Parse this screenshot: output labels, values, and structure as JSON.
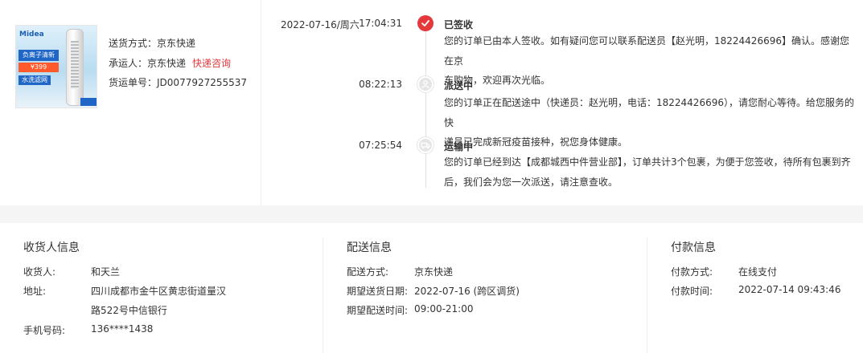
{
  "product": {
    "image_brand": "Midea",
    "image_tags": [
      "负离子清新",
      "¥399",
      "水洗滤网"
    ]
  },
  "shipping": {
    "method_label": "送货方式：",
    "method_value": "京东快递",
    "carrier_label": "承运人：",
    "carrier_value": "京东快递",
    "carrier_link": "快递咨询",
    "tracking_label": "货运单号：",
    "tracking_value": "JD0077927255537"
  },
  "timeline": {
    "date": "2022-07-16/周六",
    "events": [
      {
        "time": "17:04:31",
        "status": "已签收",
        "icon": "check-icon",
        "line1": "您的订单已由本人签收。如有疑问您可以联系配送员【赵光明，18224426696】确认。感谢您在京",
        "line2": "东购物，欢迎再次光临。"
      },
      {
        "time": "08:22:13",
        "status": "派送中",
        "icon": "courier-icon",
        "line1": "您的订单正在配送途中（快递员：赵光明，电话：18224426696），请您耐心等待。给您服务的快",
        "line2": "递员已完成新冠疫苗接种，祝您身体健康。"
      },
      {
        "time": "07:25:54",
        "status": "运输中",
        "icon": "truck-icon",
        "line1": "您的订单已经到达【成都城西中件营业部】，订单共计3个包裹，为便于您签收，待所有包裹到齐",
        "line2": "后，我们会为您一次派送，请注意查收。"
      }
    ]
  },
  "receiver": {
    "heading": "收货人信息",
    "name_label": "收货人:",
    "name_value": "和天兰",
    "address_label": "地址:",
    "address_line1": "四川成都市金牛区黄忠街道量汉",
    "address_line2": "路522号中信银行",
    "phone_label": "手机号码:",
    "phone_value": "136****1438"
  },
  "delivery": {
    "heading": "配送信息",
    "method_label": "配送方式:",
    "method_value": "京东快递",
    "date_label": "期望送货日期:",
    "date_value": "2022-07-16 (跨区调货)",
    "time_label": "期望配送时间:",
    "time_value": "09:00-21:00"
  },
  "payment": {
    "heading": "付款信息",
    "method_label": "付款方式:",
    "method_value": "在线支付",
    "time_label": "付款时间:",
    "time_value": "2022-07-14 09:43:46"
  },
  "colors": {
    "accent_red": "#e4393c",
    "border": "#eeeeee",
    "band": "#f5f5f5"
  }
}
